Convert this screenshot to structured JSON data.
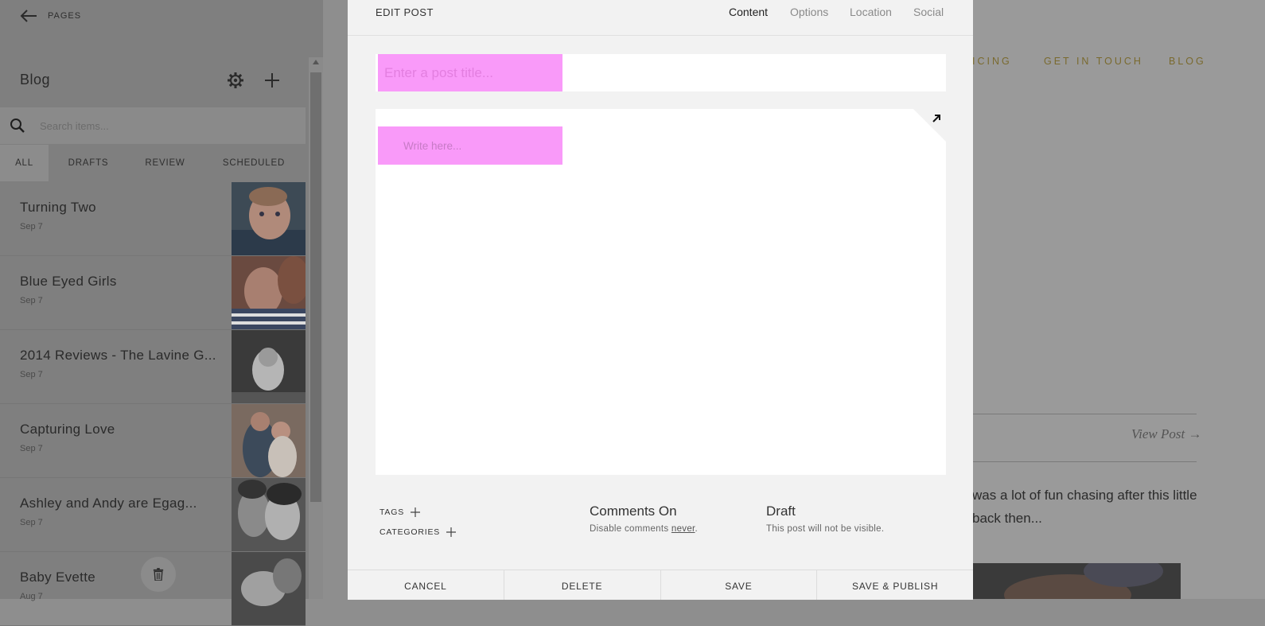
{
  "sidebar": {
    "back_label": "PAGES",
    "title": "Blog",
    "search_placeholder": "Search items...",
    "tabs": [
      {
        "label": "ALL",
        "active": true
      },
      {
        "label": "DRAFTS",
        "active": false
      },
      {
        "label": "REVIEW",
        "active": false
      },
      {
        "label": "SCHEDULED",
        "active": false
      }
    ],
    "items": [
      {
        "title": "Turning Two",
        "date": "Sep 7"
      },
      {
        "title": "Blue Eyed Girls",
        "date": "Sep 7"
      },
      {
        "title": "2014 Reviews - The Lavine G...",
        "date": "Sep 7"
      },
      {
        "title": "Capturing Love",
        "date": "Sep 7"
      },
      {
        "title": "Ashley and Andy are Egag...",
        "date": "Sep 7"
      },
      {
        "title": "Baby Evette",
        "date": "Aug 7"
      }
    ]
  },
  "site": {
    "nav": {
      "pricing": "ICING",
      "contact": "GET IN TOUCH",
      "blog": "BLOG"
    },
    "view_post": "View Post →",
    "excerpt_line1": "was a lot of fun chasing after this little",
    "excerpt_line2": "back then..."
  },
  "modal": {
    "title": "EDIT POST",
    "tabs": {
      "content": "Content",
      "options": "Options",
      "location": "Location",
      "social": "Social"
    },
    "title_placeholder": "Enter a post title...",
    "body_placeholder": "Write here...",
    "tags_label": "TAGS",
    "categories_label": "CATEGORIES",
    "comments_title": "Comments On",
    "comments_sub_prefix": "Disable comments ",
    "comments_sub_link": "never",
    "comments_sub_suffix": ".",
    "status_title": "Draft",
    "status_sub": "This post will not be visible.",
    "buttons": {
      "cancel": "CANCEL",
      "delete": "DELETE",
      "save": "SAVE",
      "save_publish": "SAVE & PUBLISH"
    }
  }
}
